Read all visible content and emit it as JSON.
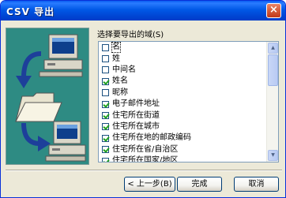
{
  "window": {
    "title": "CSV 导出",
    "close_glyph": "×"
  },
  "fields": {
    "label": "选择要导出的域(S)",
    "items": [
      {
        "label": "名",
        "checked": false
      },
      {
        "label": "姓",
        "checked": false
      },
      {
        "label": "中间名",
        "checked": false
      },
      {
        "label": "姓名",
        "checked": true
      },
      {
        "label": "昵称",
        "checked": false
      },
      {
        "label": "电子邮件地址",
        "checked": true
      },
      {
        "label": "住宅所在街道",
        "checked": true
      },
      {
        "label": "住宅所在城市",
        "checked": true
      },
      {
        "label": "住宅所在地的邮政编码",
        "checked": true
      },
      {
        "label": "住宅所在省/自治区",
        "checked": true
      },
      {
        "label": "住宅所在国家/地区",
        "checked": true
      }
    ]
  },
  "buttons": {
    "back": "< 上一步(B)",
    "finish": "完成",
    "cancel": "取消"
  },
  "colors": {
    "panel_bg": "#2e8b83",
    "title_bar": "#0058e6",
    "check_mark": "#21a121"
  }
}
